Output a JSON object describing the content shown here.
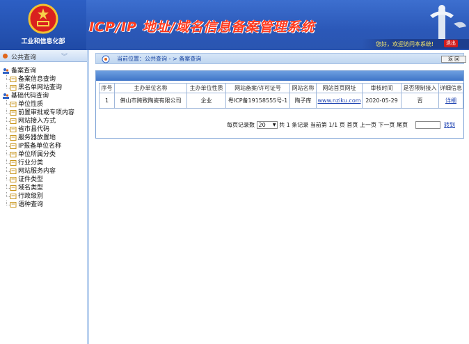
{
  "header": {
    "ministry": "工业和信息化部",
    "title": "ICP/IP 地址/域名信息备案管理系统",
    "welcome": "您好，欢迎访问本系统!",
    "logout": "退出"
  },
  "sidebar": {
    "title": "公共查询",
    "groups": [
      {
        "label": "备案查询",
        "items": [
          "备案信息查询",
          "黑名单网站查询"
        ]
      },
      {
        "label": "基础代码查询",
        "items": [
          "单位性质",
          "前置审批或专项内容",
          "网站接入方式",
          "省市县代码",
          "服务器放置地",
          "IP报备单位名称",
          "单位所属分类",
          "行业分类",
          "网站服务内容",
          "证件类型",
          "域名类型",
          "行政级别",
          "语种查询"
        ]
      }
    ]
  },
  "location": {
    "text": "当前位置：公共查询   - >  备案查询",
    "back": "返  回"
  },
  "table": {
    "headers": [
      "序号",
      "主办单位名称",
      "主办单位性质",
      "网站备案/许可证号",
      "网站名称",
      "网站首页网址",
      "审核时间",
      "是否限制接入",
      "详细信息"
    ],
    "rows": [
      [
        "1",
        "佛山市跨致陶瓷有限公司",
        "企业",
        "粤ICP备19158555号-1",
        "陶子库",
        "www.nziku.com",
        "2020-05-29",
        "否",
        "详细"
      ]
    ]
  },
  "pager": {
    "per_page_label": "每页记录数",
    "per_page_value": "20",
    "summary": "共 1 条记录  当前第 1/1 页 首页 上一页 下一页 尾页",
    "go": "转到"
  },
  "colors": {
    "header_blue": "#2b58b8",
    "title_red": "#ff3b1f",
    "link_blue": "#1a3fb0"
  }
}
